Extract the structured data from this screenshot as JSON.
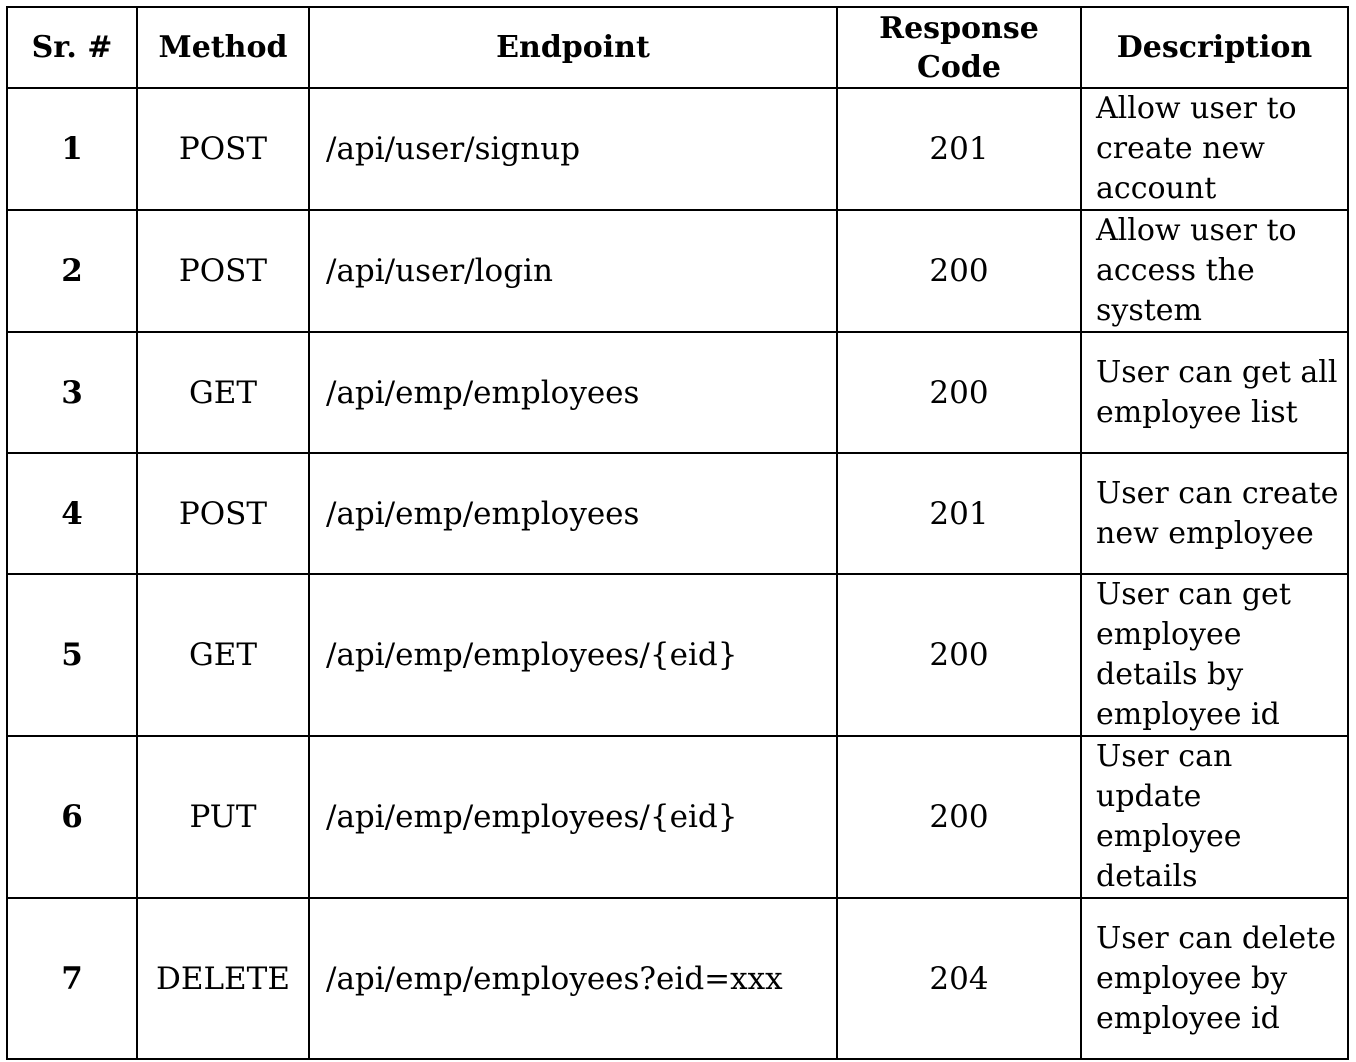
{
  "headers": {
    "sr": "Sr. #",
    "method": "Method",
    "endpoint": "Endpoint",
    "response_code": "Response Code",
    "description": "Description"
  },
  "rows": [
    {
      "sr": "1",
      "method": "POST",
      "endpoint": "/api/user/signup",
      "code": "201",
      "description": "Allow user to create new account"
    },
    {
      "sr": "2",
      "method": "POST",
      "endpoint": "/api/user/login",
      "code": "200",
      "description": "Allow user to access the system"
    },
    {
      "sr": "3",
      "method": "GET",
      "endpoint": "/api/emp/employees",
      "code": "200",
      "description": "User can get all employee list"
    },
    {
      "sr": "4",
      "method": "POST",
      "endpoint": "/api/emp/employees",
      "code": "201",
      "description": "User can create new employee"
    },
    {
      "sr": "5",
      "method": "GET",
      "endpoint": "/api/emp/employees/{eid}",
      "code": "200",
      "description": "User can get employee details by employee id"
    },
    {
      "sr": "6",
      "method": "PUT",
      "endpoint": "/api/emp/employees/{eid}",
      "code": "200",
      "description": "User can update employee details"
    },
    {
      "sr": "7",
      "method": "DELETE",
      "endpoint": "/api/emp/employees?eid=xxx",
      "code": "204",
      "description": "User can delete employee by employee id"
    }
  ]
}
